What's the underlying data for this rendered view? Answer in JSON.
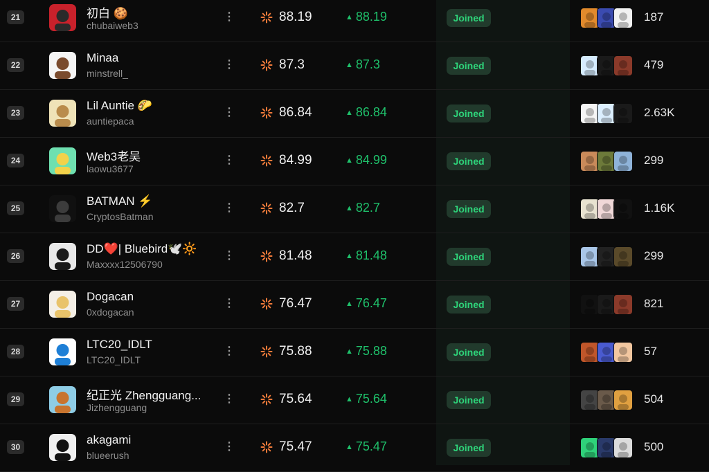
{
  "joined_label": "Joined",
  "more_icon": "more-vertical-icon",
  "score_icon": "spark-icon",
  "delta_icon": "triangle-up-icon",
  "colors": {
    "positive": "#1fc16b",
    "score_icon": "#f27b3a",
    "joined_bg": "#213a2c",
    "joined_text": "#2ed47a"
  },
  "rows": [
    {
      "rank": "21",
      "name": "初白 🍪",
      "handle": "chubaiweb3",
      "score": "88.19",
      "delta": "88.19",
      "followers": "187",
      "avatar_colors": [
        "#c8212b",
        "#2a2a2a"
      ],
      "mini": [
        "#e28a2c",
        "#3b4bb0",
        "#f1f1f1"
      ]
    },
    {
      "rank": "22",
      "name": "Minaa",
      "handle": "minstrell_",
      "score": "87.3",
      "delta": "87.3",
      "followers": "479",
      "avatar_colors": [
        "#f5f5f5",
        "#7a4b2e"
      ],
      "mini": [
        "#d6ecff",
        "#1a1a1a",
        "#8b3a2a"
      ]
    },
    {
      "rank": "23",
      "name": "Lil Auntie 🌮",
      "handle": "auntiepaca",
      "score": "86.84",
      "delta": "86.84",
      "followers": "2.63K",
      "avatar_colors": [
        "#efe3b8",
        "#b98c4c"
      ],
      "mini": [
        "#f5f5f5",
        "#dcefff",
        "#1a1a1a"
      ]
    },
    {
      "rank": "24",
      "name": "Web3老吴",
      "handle": "laowu3677",
      "score": "84.99",
      "delta": "84.99",
      "followers": "299",
      "avatar_colors": [
        "#6ee0b0",
        "#f2d24a"
      ],
      "mini": [
        "#c98a5a",
        "#6d7a3a",
        "#8fb3d9"
      ]
    },
    {
      "rank": "25",
      "name": "BATMAN ⚡",
      "handle": "CryptosBatman",
      "score": "82.7",
      "delta": "82.7",
      "followers": "1.16K",
      "avatar_colors": [
        "#101010",
        "#3c3c3c"
      ],
      "mini": [
        "#e8e2d0",
        "#f0d8d8",
        "#111111"
      ]
    },
    {
      "rank": "26",
      "name": "DD❤️| Bluebird🕊️🔆",
      "handle": "Maxxxx12506790",
      "score": "81.48",
      "delta": "81.48",
      "followers": "299",
      "avatar_colors": [
        "#e8e8e8",
        "#1a1a1a"
      ],
      "mini": [
        "#a9c6e8",
        "#222222",
        "#5a4a2a"
      ]
    },
    {
      "rank": "27",
      "name": "Dogacan",
      "handle": "0xdogacan",
      "score": "76.47",
      "delta": "76.47",
      "followers": "821",
      "avatar_colors": [
        "#f4efe6",
        "#e9c36a"
      ],
      "mini": [
        "#111111",
        "#1a1a1a",
        "#8b3a2a"
      ]
    },
    {
      "rank": "28",
      "name": "LTC20_IDLT",
      "handle": "LTC20_IDLT",
      "score": "75.88",
      "delta": "75.88",
      "followers": "57",
      "avatar_colors": [
        "#ffffff",
        "#1e7fd6"
      ],
      "mini": [
        "#c0562a",
        "#4a5bd0",
        "#f2c7a0"
      ]
    },
    {
      "rank": "29",
      "name": "纪正光 Zhengguang...",
      "handle": "Jizhengguang",
      "score": "75.64",
      "delta": "75.64",
      "followers": "504",
      "avatar_colors": [
        "#8ecde6",
        "#c8742e"
      ],
      "mini": [
        "#444444",
        "#6a5a4a",
        "#e0a040"
      ]
    },
    {
      "rank": "30",
      "name": "akagami",
      "handle": "blueerush",
      "score": "75.47",
      "delta": "75.47",
      "followers": "500",
      "avatar_colors": [
        "#f0f0f0",
        "#111111"
      ],
      "mini": [
        "#2fd27a",
        "#2a3a6a",
        "#dcdcdc"
      ]
    }
  ]
}
